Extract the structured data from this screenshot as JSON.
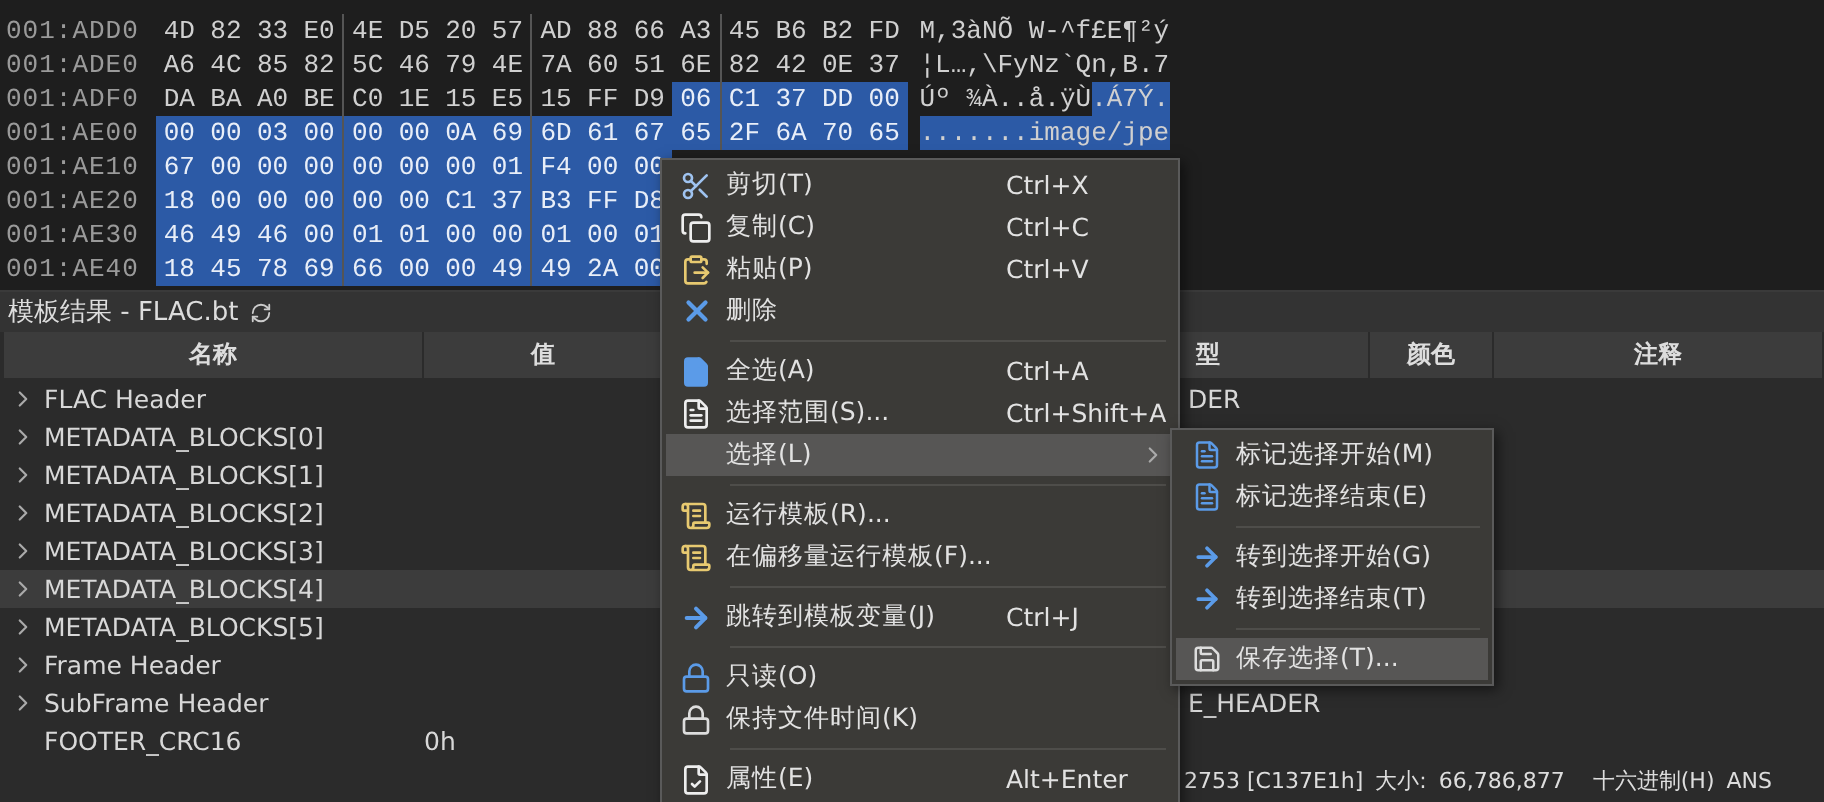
{
  "hex_view": {
    "rows": [
      {
        "offset": "001:ADD0",
        "bytes": "4D 82 33 E0 4E D5 20 57 AD 88 66 A3 45 B6 B2 FD",
        "ascii": "M,3àNÕ W-^f£E¶²ý"
      },
      {
        "offset": "001:ADE0",
        "bytes": "A6 4C 85 82 5C 46 79 4E 7A 60 51 6E 82 42 0E 37",
        "ascii": "¦L…,\\FyNz`Qn,B.7"
      },
      {
        "offset": "001:ADF0",
        "bytes": "DA BA A0 BE C0 1E 15 E5 15 FF D9",
        "selected_bytes": "06 C1 37 DD 00",
        "ascii": "Úº ¾À..å.ÿÙ",
        "selected_ascii": ".Á7Ý."
      },
      {
        "offset": "001:AE00",
        "selected_bytes": "00 00 03 00 00 00 0A 69 6D 61 67 65 2F 6A 70 65",
        "selected_ascii": ".......image/jpe"
      },
      {
        "offset": "001:AE10",
        "selected_bytes": "67 00 00 00 00 00 00 01 F4 00 00"
      },
      {
        "offset": "001:AE20",
        "selected_bytes": "18 00 00 00 00 00 C1 37 B3 FF D8"
      },
      {
        "offset": "001:AE30",
        "selected_bytes": "46 49 46 00 01 01 00 00 01 00 01"
      },
      {
        "offset": "001:AE40",
        "selected_bytes": "18 45 78 69 66 00 00 49 49 2A 00"
      }
    ]
  },
  "template_results": {
    "title": "模板结果 - FLAC.bt",
    "columns": [
      {
        "label": "名称"
      },
      {
        "label": "值"
      },
      {
        "label": "型"
      },
      {
        "label": "颜色"
      },
      {
        "label": "注释"
      }
    ],
    "rows": [
      {
        "name": "FLAC Header",
        "expandable": true,
        "selected": false,
        "type": "DER"
      },
      {
        "name": "METADATA_BLOCKS[0]",
        "expandable": true,
        "selected": false
      },
      {
        "name": "METADATA_BLOCKS[1]",
        "expandable": true,
        "selected": false
      },
      {
        "name": "METADATA_BLOCKS[2]",
        "expandable": true,
        "selected": false
      },
      {
        "name": "METADATA_BLOCKS[3]",
        "expandable": true,
        "selected": false
      },
      {
        "name": "METADATA_BLOCKS[4]",
        "expandable": true,
        "selected": true
      },
      {
        "name": "METADATA_BLOCKS[5]",
        "expandable": true,
        "selected": false
      },
      {
        "name": "Frame Header",
        "expandable": true,
        "selected": false
      },
      {
        "name": "SubFrame Header",
        "expandable": true,
        "selected": false,
        "type": "E_HEADER"
      },
      {
        "name": "FOOTER_CRC16",
        "expandable": false,
        "selected": false,
        "value": "0h"
      }
    ]
  },
  "status_bar": {
    "position": "2753 [C137E1h]",
    "size_label": "大小:",
    "size": "66,786,877",
    "mode": "十六进制(H)",
    "encoding": "ANS"
  },
  "context_menu": {
    "items": [
      {
        "kind": "item",
        "label": "剪切(T)",
        "shortcut": "Ctrl+X",
        "selected": false
      },
      {
        "kind": "item",
        "label": "复制(C)",
        "shortcut": "Ctrl+C",
        "selected": false
      },
      {
        "kind": "item",
        "label": "粘贴(P)",
        "shortcut": "Ctrl+V",
        "selected": false
      },
      {
        "kind": "item",
        "label": "删除",
        "selected": false
      },
      {
        "kind": "separator"
      },
      {
        "kind": "item",
        "label": "全选(A)",
        "shortcut": "Ctrl+A",
        "selected": false
      },
      {
        "kind": "item",
        "label": "选择范围(S)...",
        "shortcut": "Ctrl+Shift+A",
        "selected": false
      },
      {
        "kind": "submenu",
        "label": "选择(L)",
        "selected": true
      },
      {
        "kind": "separator"
      },
      {
        "kind": "item",
        "label": "运行模板(R)...",
        "selected": false
      },
      {
        "kind": "item",
        "label": "在偏移量运行模板(F)...",
        "selected": false
      },
      {
        "kind": "separator"
      },
      {
        "kind": "item",
        "label": "跳转到模板变量(J)",
        "shortcut": "Ctrl+J",
        "selected": false
      },
      {
        "kind": "separator"
      },
      {
        "kind": "item",
        "label": "只读(O)",
        "selected": false
      },
      {
        "kind": "item",
        "label": "保持文件时间(K)",
        "selected": false
      },
      {
        "kind": "separator"
      },
      {
        "kind": "item",
        "label": "属性(E)",
        "shortcut": "Alt+Enter",
        "selected": false
      }
    ]
  },
  "submenu": {
    "items": [
      {
        "kind": "item",
        "label": "标记选择开始(M)",
        "selected": false
      },
      {
        "kind": "item",
        "label": "标记选择结束(E)",
        "selected": false
      },
      {
        "kind": "separator"
      },
      {
        "kind": "item",
        "label": "转到选择开始(G)",
        "selected": false
      },
      {
        "kind": "item",
        "label": "转到选择结束(T)",
        "selected": false
      },
      {
        "kind": "separator"
      },
      {
        "kind": "item",
        "label": "保存选择(T)...",
        "selected": true
      }
    ]
  }
}
